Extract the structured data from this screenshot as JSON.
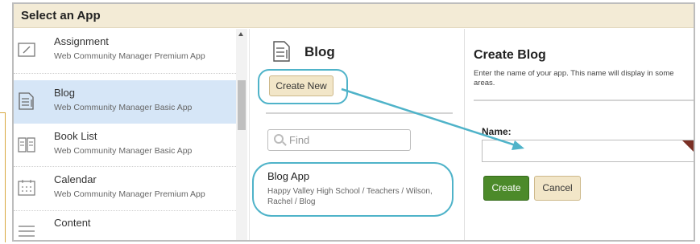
{
  "dialog": {
    "title": "Select an App"
  },
  "apps": [
    {
      "name": "Assignment",
      "subtitle": "Web Community Manager Premium App",
      "icon": "assignment-pencil-icon"
    },
    {
      "name": "Blog",
      "subtitle": "Web Community Manager Basic App",
      "icon": "blog-document-icon"
    },
    {
      "name": "Book List",
      "subtitle": "Web Community Manager Basic App",
      "icon": "book-icon"
    },
    {
      "name": "Calendar",
      "subtitle": "Web Community Manager Premium App",
      "icon": "calendar-icon"
    },
    {
      "name": "Content",
      "subtitle": "",
      "icon": "content-lines-icon"
    }
  ],
  "selected_app": "Blog",
  "middle": {
    "heading": "Blog",
    "create_new_label": "Create New",
    "find_placeholder": "Find",
    "result": {
      "title": "Blog App",
      "path": "Happy Valley High School / Teachers / Wilson, Rachel / Blog"
    }
  },
  "right": {
    "heading": "Create Blog",
    "description": "Enter the name of your app. This name will display in some areas.",
    "name_label": "Name:",
    "name_value": "",
    "create_label": "Create",
    "cancel_label": "Cancel"
  },
  "colors": {
    "titlebar_bg": "#f3ebd6",
    "selected_bg": "#d6e6f7",
    "annotation": "#4fb3c9",
    "create_button": "#4c8a2a",
    "tan_button": "#f2e6c8"
  }
}
